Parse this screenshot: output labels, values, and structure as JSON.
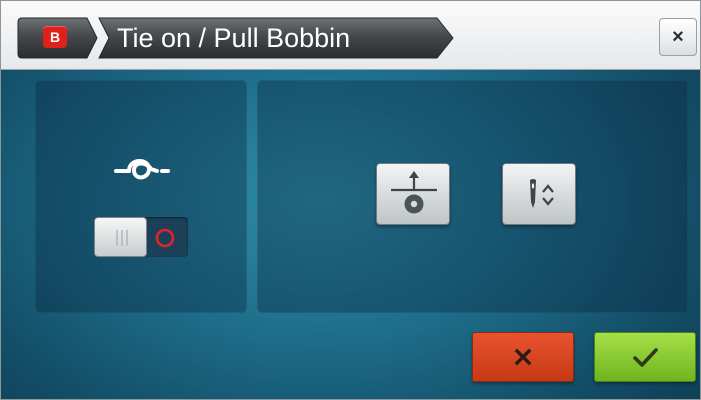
{
  "window": {
    "badge": "B",
    "title": "Tie on / Pull Bobbin",
    "close_label": "×"
  },
  "icons": {
    "brand": "brand-b-badge",
    "tie_on": "knot-tie-on-icon",
    "toggle_on": "toggle-on-bars-icon",
    "toggle_off": "toggle-off-circle-icon",
    "pull_bobbin": "pull-bobbin-icon",
    "needle_position": "needle-up-down-icon",
    "cancel": "cancel-x-icon",
    "confirm": "confirm-check-icon"
  },
  "tie_on": {
    "toggle_state": "on"
  },
  "colors": {
    "brand_red": "#e0201a",
    "panel_blue": "#1d6c89",
    "cancel_red": "#d4441f",
    "confirm_green": "#8cc93a"
  }
}
